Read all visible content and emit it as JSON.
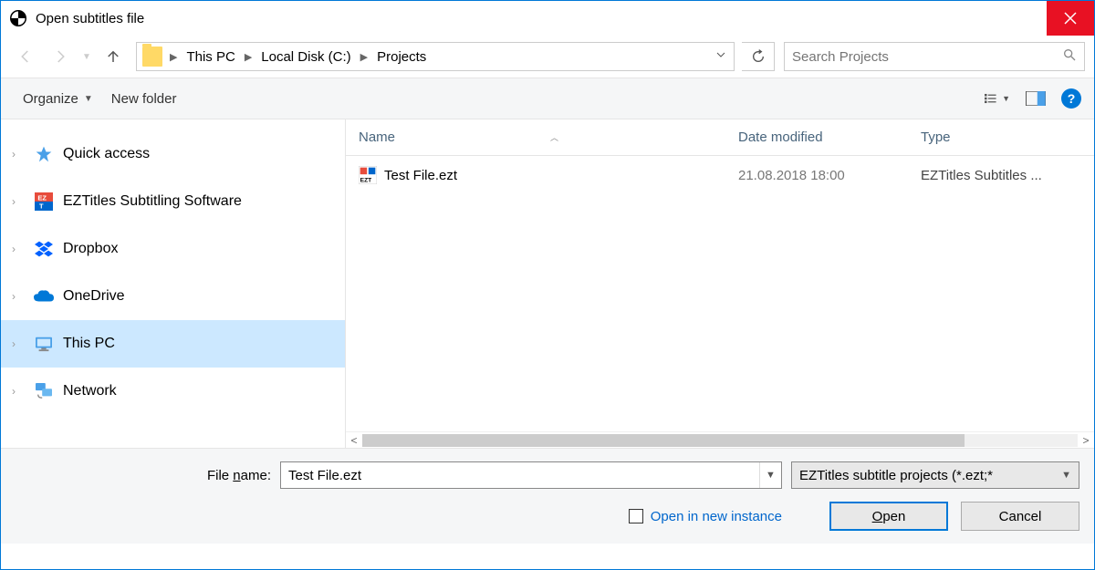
{
  "title": "Open subtitles file",
  "breadcrumb": [
    "This PC",
    "Local Disk (C:)",
    "Projects"
  ],
  "search": {
    "placeholder": "Search Projects"
  },
  "toolbar": {
    "organize": "Organize",
    "newFolder": "New folder"
  },
  "columns": {
    "name": "Name",
    "date": "Date modified",
    "type": "Type"
  },
  "files": [
    {
      "name": "Test File.ezt",
      "date": "21.08.2018 18:00",
      "type": "EZTitles Subtitles ..."
    }
  ],
  "sidebar": {
    "items": [
      {
        "label": "Quick access",
        "icon": "star"
      },
      {
        "label": "EZTitles Subtitling Software",
        "icon": "ez"
      },
      {
        "label": "Dropbox",
        "icon": "dropbox"
      },
      {
        "label": "OneDrive",
        "icon": "onedrive"
      },
      {
        "label": "This PC",
        "icon": "pc",
        "selected": true
      },
      {
        "label": "Network",
        "icon": "network"
      }
    ]
  },
  "footer": {
    "fileNameLabel": "File name:",
    "fileNameValue": "Test File.ezt",
    "filterLabel": "EZTitles subtitle projects (*.ezt;*",
    "openInNew": "Open in new instance",
    "openBtn": "Open",
    "cancelBtn": "Cancel"
  }
}
